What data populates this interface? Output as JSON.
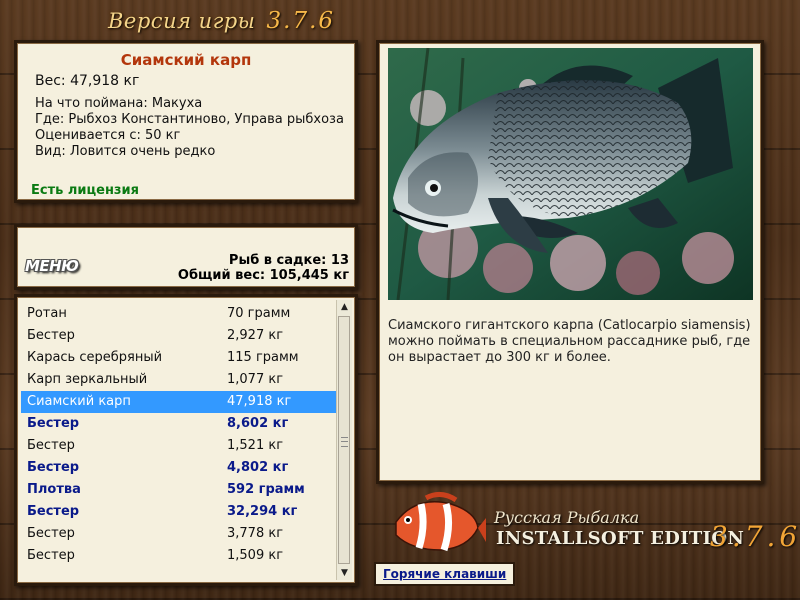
{
  "header": {
    "title": "Версия игры",
    "version": "3.7.6"
  },
  "fish_info": {
    "name": "Сиамский карп",
    "weight": "Вес: 47,918 кг",
    "caught_on": "На что поймана: Макуха",
    "where": "Где: Рыбхоз Константиново, Управа рыбхоза",
    "valued_from": "Оценивается с: 50 кг",
    "kind": "Вид: Ловится очень редко",
    "license": "Есть лицензия"
  },
  "stats": {
    "menu_label": "МЕНЮ",
    "fish_in_net": "Рыб в садке: 13",
    "total_weight": "Общий вес: 105,445 кг"
  },
  "catch_list": [
    {
      "name": "Ротан",
      "weight": "70 грамм",
      "style": "normal"
    },
    {
      "name": "Бестер",
      "weight": "2,927 кг",
      "style": "normal"
    },
    {
      "name": "Карась серебряный",
      "weight": "115 грамм",
      "style": "normal"
    },
    {
      "name": "Карп зеркальный",
      "weight": "1,077 кг",
      "style": "normal"
    },
    {
      "name": "Сиамский карп",
      "weight": "47,918 кг",
      "style": "selected"
    },
    {
      "name": "Бестер",
      "weight": "8,602 кг",
      "style": "bold"
    },
    {
      "name": "Бестер",
      "weight": "1,521 кг",
      "style": "normal"
    },
    {
      "name": "Бестер",
      "weight": "4,802 кг",
      "style": "bold"
    },
    {
      "name": "Плотва",
      "weight": "592 грамм",
      "style": "bold"
    },
    {
      "name": "Бестер",
      "weight": "32,294 кг",
      "style": "bold"
    },
    {
      "name": "Бестер",
      "weight": "3,778 кг",
      "style": "normal"
    },
    {
      "name": "Бестер",
      "weight": "1,509 кг",
      "style": "normal"
    }
  ],
  "detail": {
    "description": "Сиамского гигантского карпа (Catlocarpio siamensis) можно поймать в специальном рассаднике рыб, где он вырастает до 300 кг и более."
  },
  "logo": {
    "line1": "Русская Рыбалка",
    "line2": "INSTALLSOFT EDITION",
    "version": "3.7.6"
  },
  "footer": {
    "hotkeys_label": "Горячие клавиши"
  },
  "colors": {
    "selected_row": "#3399ff",
    "bold_row": "#0a1a8a",
    "fish_name": "#b3360c",
    "license": "#0a7a12"
  },
  "icons": [
    "scroll-up-icon",
    "scroll-down-icon",
    "clownfish-logo-icon"
  ]
}
